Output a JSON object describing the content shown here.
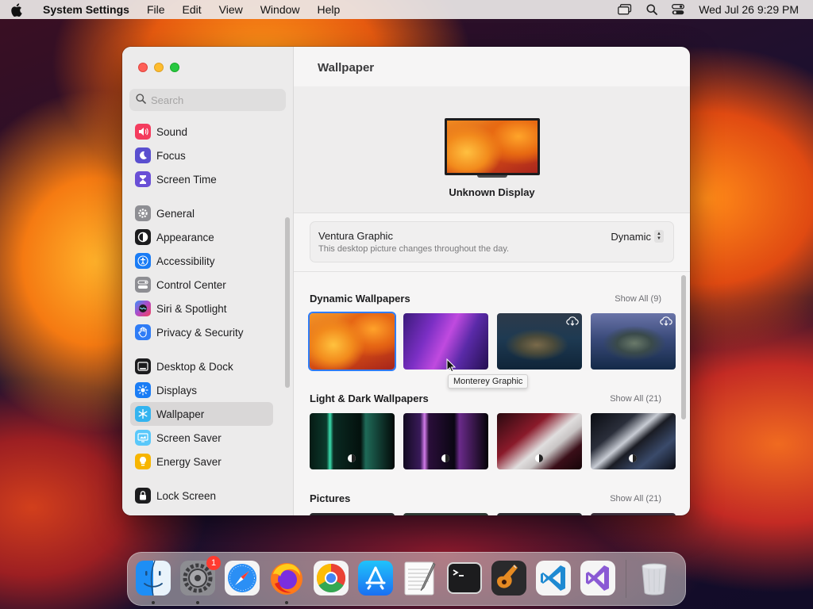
{
  "menubar": {
    "app_name": "System Settings",
    "menus": [
      "File",
      "Edit",
      "View",
      "Window",
      "Help"
    ],
    "datetime": "Wed Jul 26  9:29 PM"
  },
  "sidebar": {
    "search_placeholder": "Search",
    "groups": [
      [
        {
          "label": "Sound",
          "icon": "speaker-icon",
          "color": "#f43c5e"
        },
        {
          "label": "Focus",
          "icon": "moon-icon",
          "color": "#5a4fcf"
        },
        {
          "label": "Screen Time",
          "icon": "hourglass-icon",
          "color": "#6a4fd6"
        }
      ],
      [
        {
          "label": "General",
          "icon": "gear-icon",
          "color": "#8e8e93"
        },
        {
          "label": "Appearance",
          "icon": "appearance-icon",
          "color": "#1c1c1e"
        },
        {
          "label": "Accessibility",
          "icon": "accessibility-icon",
          "color": "#1a7cf5"
        },
        {
          "label": "Control Center",
          "icon": "control-center-icon",
          "color": "#8e8e93"
        },
        {
          "label": "Siri & Spotlight",
          "icon": "siri-icon",
          "color": "#b24ac6"
        },
        {
          "label": "Privacy & Security",
          "icon": "hand-icon",
          "color": "#2f7cf6"
        }
      ],
      [
        {
          "label": "Desktop & Dock",
          "icon": "desktop-dock-icon",
          "color": "#1c1c1e"
        },
        {
          "label": "Displays",
          "icon": "sun-icon",
          "color": "#1a7cf5"
        },
        {
          "label": "Wallpaper",
          "icon": "snowflake-icon",
          "color": "#33b4f0",
          "active": true
        },
        {
          "label": "Screen Saver",
          "icon": "screen-saver-icon",
          "color": "#5ac8fa"
        },
        {
          "label": "Energy Saver",
          "icon": "bulb-icon",
          "color": "#f7b500"
        }
      ],
      [
        {
          "label": "Lock Screen",
          "icon": "lock-icon",
          "color": "#1c1c1e"
        }
      ]
    ]
  },
  "content": {
    "title": "Wallpaper",
    "display_name": "Unknown Display",
    "current_wallpaper": {
      "name": "Ventura Graphic",
      "description": "This desktop picture changes throughout the day.",
      "mode": "Dynamic"
    },
    "sections": [
      {
        "title": "Dynamic Wallpapers",
        "show_all": "Show All (9)"
      },
      {
        "title": "Light & Dark Wallpapers",
        "show_all": "Show All (21)"
      },
      {
        "title": "Pictures",
        "show_all": "Show All (21)"
      }
    ],
    "tooltip": "Monterey Graphic"
  },
  "dock": {
    "apps": [
      {
        "name": "Finder",
        "icon": "finder-icon",
        "running": true
      },
      {
        "name": "System Settings",
        "icon": "system-settings-icon",
        "running": true,
        "badge": "1"
      },
      {
        "name": "Safari",
        "icon": "safari-icon",
        "running": false
      },
      {
        "name": "Firefox",
        "icon": "firefox-icon",
        "running": true
      },
      {
        "name": "Chrome",
        "icon": "chrome-icon",
        "running": false
      },
      {
        "name": "App Store",
        "icon": "app-store-icon",
        "running": false
      },
      {
        "name": "TextEdit",
        "icon": "textedit-icon",
        "running": false
      },
      {
        "name": "Terminal",
        "icon": "terminal-icon",
        "running": false
      },
      {
        "name": "GarageBand",
        "icon": "guitar-icon",
        "running": false
      },
      {
        "name": "VS Code",
        "icon": "vscode-icon",
        "running": false
      },
      {
        "name": "Visual Studio",
        "icon": "visual-studio-icon",
        "running": false
      }
    ],
    "trash_icon": "trash-icon"
  }
}
